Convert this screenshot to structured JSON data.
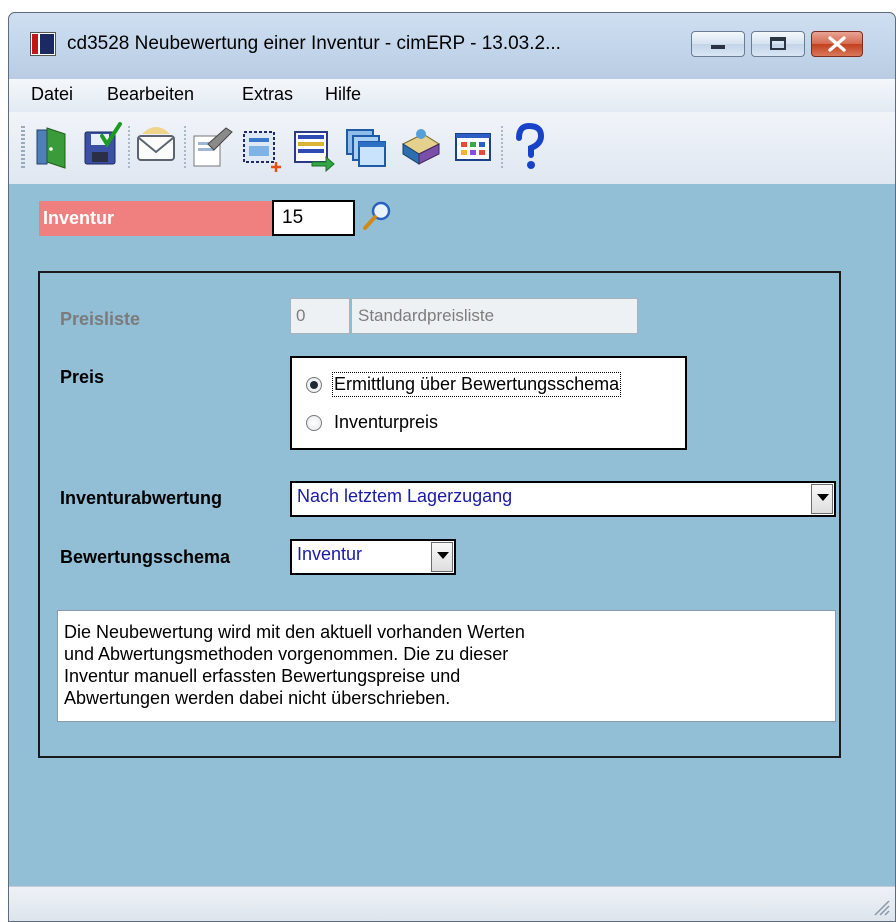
{
  "window": {
    "title": "cd3528 Neubewertung einer Inventur - cimERP - 13.03.2...",
    "controls": [
      "minimize-icon",
      "maximize-icon",
      "close-icon"
    ]
  },
  "menu": {
    "items": [
      "Datei",
      "Bearbeiten",
      "Extras",
      "Hilfe"
    ]
  },
  "toolbar": {
    "icons": [
      "exit-door-icon",
      "save-icon",
      "mail-icon",
      "edit-document-icon",
      "new-record-icon",
      "import-list-icon",
      "windows-icon",
      "book-icon",
      "grid-window-icon",
      "help-icon"
    ]
  },
  "form": {
    "inventur_label": "Inventur",
    "inventur_value": "15",
    "preisliste_label": "Preisliste",
    "preisliste_number": "0",
    "preisliste_name": "Standardpreisliste",
    "preis_label": "Preis",
    "preis_options": [
      {
        "label": "Ermittlung über Bewertungsschema",
        "checked": true
      },
      {
        "label": "Inventurpreis",
        "checked": false
      }
    ],
    "inventurabwertung_label": "Inventurabwertung",
    "inventurabwertung_value": "Nach letztem Lagerzugang",
    "bewertungsschema_label": "Bewertungsschema",
    "bewertungsschema_value": "Inventur",
    "description_lines": [
      "Die Neubewertung wird mit den aktuell vorhanden Werten",
      "und Abwertungsmethoden vorgenommen. Die zu dieser",
      "Inventur manuell erfassten Bewertungspreise und",
      "Abwertungen werden dabei nicht überschrieben."
    ]
  },
  "colors": {
    "form_background": "#93bfd6",
    "inventur_label_bg": "#f08080",
    "select_text": "#1a1aa8"
  }
}
